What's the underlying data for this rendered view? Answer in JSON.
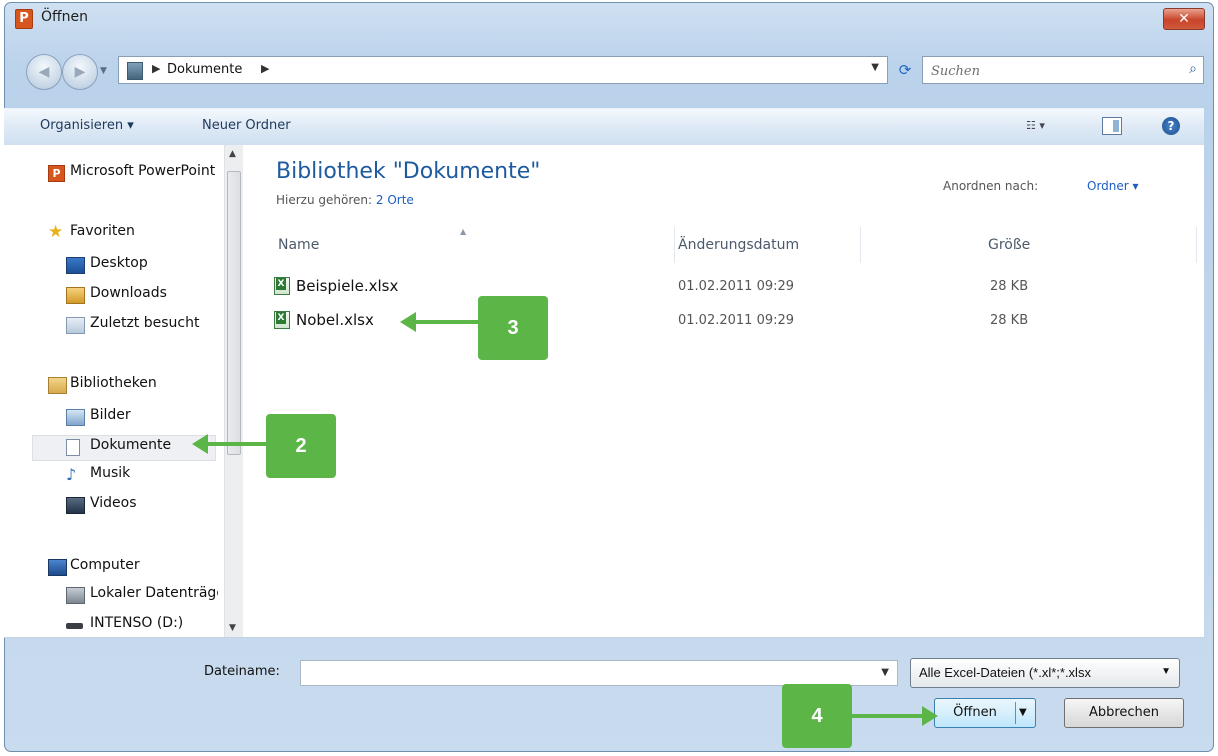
{
  "window": {
    "title": "Öffnen",
    "app_icon_letter": "P",
    "close_glyph": "✕"
  },
  "navbar": {
    "breadcrumb": "Dokumente",
    "separator": "▶",
    "search_placeholder": "Suchen"
  },
  "toolbar": {
    "organize": "Organisieren ▾",
    "new_folder": "Neuer Ordner",
    "view_glyph": "☷ ▾",
    "help_glyph": "?"
  },
  "sidebar": {
    "items": [
      {
        "label": "Microsoft PowerPoint",
        "icon": "powerpoint-icon"
      },
      {
        "label": "Favoriten",
        "icon": "star-icon"
      },
      {
        "label": "Desktop",
        "icon": "desktop-icon"
      },
      {
        "label": "Downloads",
        "icon": "downloads-icon"
      },
      {
        "label": "Zuletzt besucht",
        "icon": "recent-icon"
      },
      {
        "label": "Bibliotheken",
        "icon": "libraries-icon"
      },
      {
        "label": "Bilder",
        "icon": "pictures-icon"
      },
      {
        "label": "Dokumente",
        "icon": "documents-icon",
        "selected": true
      },
      {
        "label": "Musik",
        "icon": "music-icon"
      },
      {
        "label": "Videos",
        "icon": "videos-icon"
      },
      {
        "label": "Computer",
        "icon": "computer-icon"
      },
      {
        "label": "Lokaler Datenträger",
        "icon": "local-disk-icon"
      },
      {
        "label": "INTENSO (D:)",
        "icon": "drive-icon"
      }
    ]
  },
  "main": {
    "library_title": "Bibliothek \"Dokumente\"",
    "includes_label": "Hierzu gehören:",
    "includes_link": "2 Orte",
    "arrange_label": "Anordnen nach:",
    "arrange_value": "Ordner ▾",
    "columns": {
      "name": "Name",
      "date": "Änderungsdatum",
      "size": "Größe"
    },
    "files": [
      {
        "name": "Beispiele.xlsx",
        "date": "01.02.2011 09:29",
        "size": "28 KB"
      },
      {
        "name": "Nobel.xlsx",
        "date": "01.02.2011 09:29",
        "size": "28 KB"
      }
    ]
  },
  "bottom": {
    "filename_label": "Dateiname:",
    "filename_value": "",
    "filter_value": "Alle Excel-Dateien (*.xl*;*.xlsx",
    "open_label": "Öffnen",
    "cancel_label": "Abbrechen"
  },
  "callouts": {
    "c2": "2",
    "c3": "3",
    "c4": "4"
  },
  "colors": {
    "callout": "#5cb547",
    "library_title": "#1e5a9e",
    "link": "#1d5ec4"
  }
}
